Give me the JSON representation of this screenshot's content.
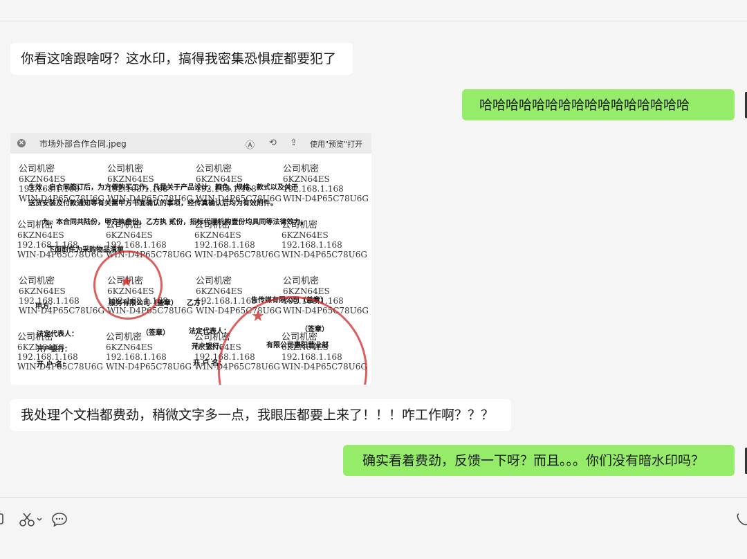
{
  "messages": [
    {
      "side": "left",
      "text": "你看这啥跟啥呀？这水印，搞得我密集恐惧症都要犯了"
    },
    {
      "side": "right",
      "text": "哈哈哈哈哈哈哈哈哈哈哈哈哈哈哈哈"
    },
    {
      "side": "left",
      "text": "我处理个文档都费劲，稍微文字多一点，我眼压都要上来了！！！咋工作啊？？？"
    },
    {
      "side": "right",
      "text": "确实看着费劲，反馈一下呀？而且。。。你们没有暗水印吗？"
    }
  ],
  "file_card": {
    "file_name": "市场外部合作合同.jpeg",
    "open_label": "使用\"预览\"打开",
    "close_icon": "close-icon",
    "watermark": {
      "line1": "公司机密",
      "line2": "6KZN64ES",
      "line3": "192.168.1.168",
      "line4": "WIN-D4P65C78U6G"
    },
    "clauses": [
      "生效，自合同签订后，为方便购买工作，凡是关于产品设计、颜色、规格、款式以及关于",
      "送货安装及付款通知等有关需甲方书面确认的事项，经传真确认后均为有效附件。",
      "九、本合同共陆份，甲方执叁份，乙方执 贰份，招标代理机构壹份均具同等法律效力。",
      "下面附件为采购物品清单",
      "甲方：",
      "服务有限公司（盖章）",
      "乙方：",
      "告传媒有限公司（盖章）",
      "法定代表人：",
      "（签章）",
      "法定代表人：",
      "（签章）",
      "开户银行：",
      "开户银行：",
      "有限公司惠阳营业部",
      "开 户 名：",
      "开 户 名："
    ]
  },
  "toolbar": {
    "folder_icon": "folder-icon",
    "scissors_icon": "scissors-icon",
    "chat_icon": "chat-icon",
    "phone_icon": "phone-icon"
  },
  "colors": {
    "self_bubble": "#95ec69",
    "other_bubble": "#ffffff",
    "background": "#f5f5f5"
  }
}
